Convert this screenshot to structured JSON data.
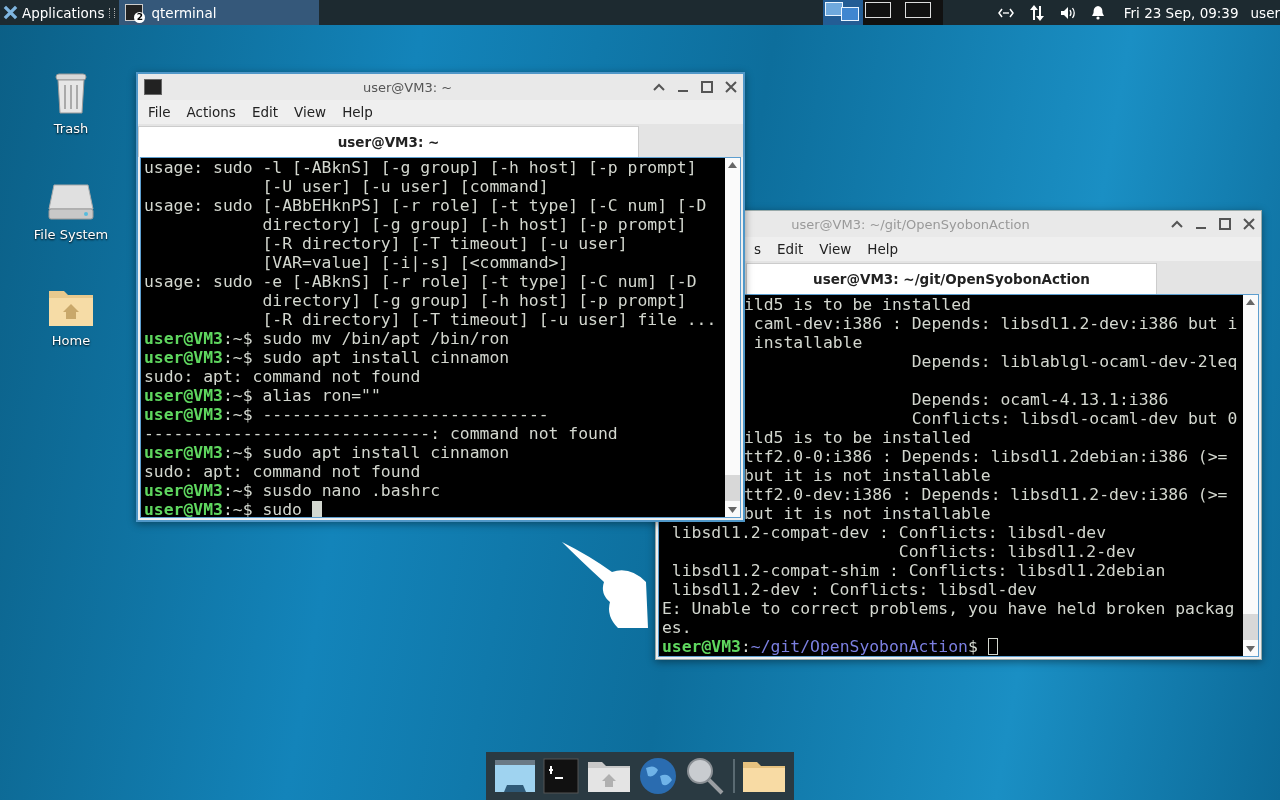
{
  "panel": {
    "applications_label": "Applications",
    "tasks": [
      {
        "label": "qterminal",
        "badge": "2",
        "selected": true
      }
    ],
    "workspaces": [
      {
        "selected": true
      },
      {
        "selected": false
      },
      {
        "selected": false
      }
    ],
    "clock": "Fri 23 Sep, 09:39",
    "user": "user"
  },
  "desktop_icons": [
    {
      "kind": "trash",
      "label": "Trash"
    },
    {
      "kind": "drive",
      "label": "File System"
    },
    {
      "kind": "home",
      "label": "Home"
    }
  ],
  "windows": [
    {
      "title": "user@VM3: ~/git/OpenSyobonAction",
      "active": false,
      "menu": [
        "s",
        "Edit",
        "View",
        "Help"
      ],
      "tab": {
        "label": "user@VM3: ~/git/OpenSyobonAction",
        "selected": true
      },
      "lines": [
        {
          "kind": "clipped",
          "text": "ild5 is to be installed"
        },
        {
          "kind": "clipped",
          "text": " caml-dev:i386 : Depends: libsdl1.2-dev:i386 but i"
        },
        {
          "kind": "clipped",
          "text": " installable"
        },
        {
          "kind": "clipped",
          "text": "                 Depends: liblablgl-ocaml-dev-2leq"
        },
        {
          "kind": "blank"
        },
        {
          "kind": "clipped",
          "text": "                 Depends: ocaml-4.13.1:i386"
        },
        {
          "kind": "clipped",
          "text": "                 Conflicts: libsdl-ocaml-dev but 0"
        },
        {
          "kind": "clipped",
          "text": "ild5 is to be installed"
        },
        {
          "kind": "clipped",
          "text": "ttf2.0-0:i386 : Depends: libsdl1.2debian:i386 (>="
        },
        {
          "kind": "clipped",
          "text": "but it is not installable"
        },
        {
          "kind": "clipped",
          "text": "ttf2.0-dev:i386 : Depends: libsdl1.2-dev:i386 (>="
        },
        {
          "kind": "clipped",
          "text": "but it is not installable"
        },
        {
          "kind": "out",
          "text": " libsdl1.2-compat-dev : Conflicts: libsdl-dev"
        },
        {
          "kind": "out",
          "text": "                        Conflicts: libsdl1.2-dev"
        },
        {
          "kind": "out",
          "text": " libsdl1.2-compat-shim : Conflicts: libsdl1.2debian"
        },
        {
          "kind": "out",
          "text": " libsdl1.2-dev : Conflicts: libsdl-dev"
        },
        {
          "kind": "out",
          "text": "E: Unable to correct problems, you have held broken packag"
        },
        {
          "kind": "out",
          "text": "es."
        },
        {
          "kind": "colorprompt",
          "user": "user@VM3",
          "colon": ":",
          "path": "~/git/OpenSyobonAction",
          "dollar": "$",
          "cursor": true
        }
      ]
    },
    {
      "title": "user@VM3: ~",
      "active": true,
      "menu": [
        "File",
        "Actions",
        "Edit",
        "View",
        "Help"
      ],
      "tab": {
        "label": "user@VM3: ~",
        "selected": true
      },
      "lines": [
        {
          "kind": "out",
          "text": "usage: sudo -l [-ABknS] [-g group] [-h host] [-p prompt]"
        },
        {
          "kind": "out",
          "text": "            [-U user] [-u user] [command]"
        },
        {
          "kind": "out",
          "text": "usage: sudo [-ABbEHknPS] [-r role] [-t type] [-C num] [-D"
        },
        {
          "kind": "out",
          "text": "            directory] [-g group] [-h host] [-p prompt]"
        },
        {
          "kind": "out",
          "text": "            [-R directory] [-T timeout] [-u user]"
        },
        {
          "kind": "out",
          "text": "            [VAR=value] [-i|-s] [<command>]"
        },
        {
          "kind": "out",
          "text": "usage: sudo -e [-ABknS] [-r role] [-t type] [-C num] [-D"
        },
        {
          "kind": "out",
          "text": "            directory] [-g group] [-h host] [-p prompt]"
        },
        {
          "kind": "out",
          "text": "            [-R directory] [-T timeout] [-u user] file ..."
        },
        {
          "kind": "prompt",
          "user": "user@VM3",
          "colon": ":",
          "path": "~",
          "dollar": "$",
          "command": "sudo mv /bin/apt /bin/ron"
        },
        {
          "kind": "prompt",
          "user": "user@VM3",
          "colon": ":",
          "path": "~",
          "dollar": "$",
          "command": "sudo apt install cinnamon"
        },
        {
          "kind": "out",
          "text": "sudo: apt: command not found"
        },
        {
          "kind": "prompt",
          "user": "user@VM3",
          "colon": ":",
          "path": "~",
          "dollar": "$",
          "command": "alias ron=\"\""
        },
        {
          "kind": "prompt",
          "user": "user@VM3",
          "colon": ":",
          "path": "~",
          "dollar": "$",
          "command": "-----------------------------"
        },
        {
          "kind": "out",
          "text": "-----------------------------: command not found"
        },
        {
          "kind": "prompt",
          "user": "user@VM3",
          "colon": ":",
          "path": "~",
          "dollar": "$",
          "command": "sudo apt install cinnamon"
        },
        {
          "kind": "out",
          "text": "sudo: apt: command not found"
        },
        {
          "kind": "prompt",
          "user": "user@VM3",
          "colon": ":",
          "path": "~",
          "dollar": "$",
          "command": "susdo nano .bashrc"
        },
        {
          "kind": "prompt",
          "user": "user@VM3",
          "colon": ":",
          "path": "~",
          "dollar": "$",
          "command": "sudo",
          "cursor": true
        }
      ]
    }
  ],
  "dock": [
    {
      "kind": "desktop"
    },
    {
      "kind": "terminal"
    },
    {
      "kind": "home"
    },
    {
      "kind": "browser"
    },
    {
      "kind": "search"
    },
    {
      "kind": "sep"
    },
    {
      "kind": "folder"
    }
  ]
}
